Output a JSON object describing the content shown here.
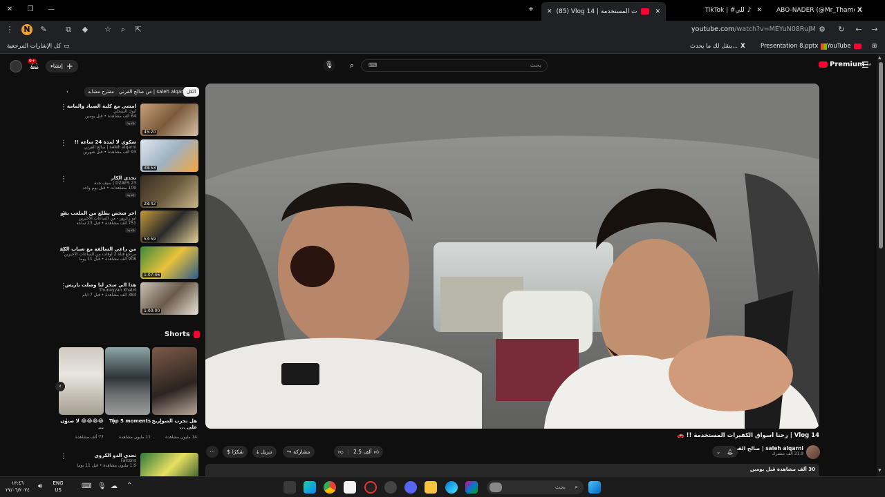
{
  "browser": {
    "tabs": [
      {
        "label": "ABO-NADER (@Mr_Thamer10",
        "icon": "x-icon"
      },
      {
        "label": "TikTok | #للي",
        "icon": "tiktok-icon"
      },
      {
        "label": "(85) Vlog 14 | ات المستخدمة",
        "icon": "youtube-icon",
        "active": true
      }
    ],
    "url_domain": "youtube.com",
    "url_path": "/watch?v=MEYuN08RuJM",
    "bookmarks": [
      {
        "label": "YouTube",
        "icon": "youtube-icon"
      },
      {
        "label": "Presentation 8.pptx",
        "icon": "office-icon"
      },
      {
        "label": "ينقل لك ما يحدث...",
        "icon": "x-icon"
      },
      {
        "label": "كل الإشارات المرجعية",
        "icon": "folder-icon"
      }
    ],
    "profile_initial": "N"
  },
  "youtube": {
    "premium_label": "Premium",
    "premium_sup": "SA",
    "search_placeholder": "بحث",
    "create_label": "إنشاء",
    "notif_count": "9+",
    "chips": [
      "الكل",
      "من صالح القرني | saleh alqarni",
      "مقترح مشابه"
    ],
    "recommendations": [
      {
        "title": "امشي مع كلبة الصياد والمامة",
        "channel": "أبوك السحلي",
        "meta": "64 ألف مشاهدة • قبل يومين",
        "badge": "جديد",
        "duration": "45:20"
      },
      {
        "title": "شكوي لا لمدة 24 ساعة !!",
        "channel": "saleh alqarni | صالح القرني",
        "meta": "93 ألف مشاهدة • قبل شهرين",
        "badge": "",
        "duration": "38:53"
      },
      {
        "title": "تحدي الكار",
        "channel": "DZAES 23 | سيف جدة",
        "meta": "109 مشاهدات • قبل يوم واحد",
        "badge": "جديد",
        "duration": "28:42"
      },
      {
        "title": "آخر شخص يطلع من الملعب يفوز 100,000 ريال !! الصراع الاخير ...",
        "channel": "ابو زعرور - من الساعات الأخيرين",
        "meta": "751 ألف مشاهدة • قبل 23 ساعة",
        "badge": "جديد",
        "duration": "53:59"
      },
      {
        "title": "من راعي السالفة مع شباب الكفرين",
        "channel": "مراجع قناة 2 أوقات من الساعات الأخيرين",
        "meta": "908 ألف مشاهدة • قبل 11 يوما",
        "badge": "",
        "duration": "1:07:46"
      },
      {
        "title": "هذا الي سحر لنا وصلت باريس",
        "channel": "Thuneyyan Khalid",
        "meta": "384 ألف مشاهدة • قبل 7 أيام",
        "badge": "",
        "duration": "1:00:00"
      }
    ],
    "shorts_label": "Shorts",
    "shorts": [
      {
        "title": "هل تجرب الصواريخ على ...",
        "views": "14 مليون مشاهدة"
      },
      {
        "title": "Top 5 moments",
        "views": "11 مليون مشاهدة"
      },
      {
        "title": "😂😂😂😂 لا صنون ...",
        "views": "77 ألف مشاهدة"
      }
    ],
    "last_rec": {
      "title": "تحدي الذو الكروي",
      "channel": "Falcons",
      "meta": "1.6 مليون مشاهدة • قبل 11 يوما"
    },
    "video": {
      "title": "Vlog 14 | رحنا أسواق الكفيرات المستخدمة !! 🚗",
      "channel": "saleh alqarni | صالح القرني",
      "subs": "31.9 ألف مشترك",
      "likes": "2.5 ألف",
      "share_label": "مشاركة",
      "download_label": "تنزيل",
      "thanks_label": "شكرًا",
      "description_meta": "30 ألف مشاهدة قبل يومين"
    }
  },
  "taskbar": {
    "search_placeholder": "بحث",
    "lang": "ENG",
    "region": "US",
    "time": "١٣:٤٦",
    "date": "٢٧/٠٦/٢٠٢٤"
  }
}
